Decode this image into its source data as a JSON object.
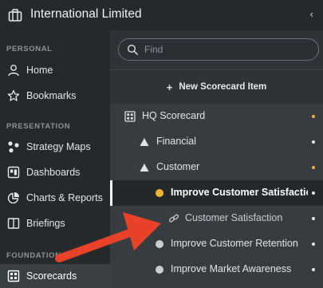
{
  "app": {
    "org_title": "International Limited",
    "collapse_glyph": "‹"
  },
  "sidebar": {
    "sections": [
      {
        "label": "PERSONAL"
      },
      {
        "label": "PRESENTATION"
      },
      {
        "label": "FOUNDATION"
      }
    ],
    "items": [
      {
        "label": "Home",
        "icon": "user-icon"
      },
      {
        "label": "Bookmarks",
        "icon": "star-icon"
      },
      {
        "label": "Strategy Maps",
        "icon": "strategy-map-icon"
      },
      {
        "label": "Dashboards",
        "icon": "dashboard-icon"
      },
      {
        "label": "Charts & Reports",
        "icon": "pie-chart-icon"
      },
      {
        "label": "Briefings",
        "icon": "book-icon"
      },
      {
        "label": "Scorecards",
        "icon": "scorecard-icon",
        "active": true
      }
    ]
  },
  "search": {
    "placeholder": "Find"
  },
  "toolbar": {
    "new_item_label": "New Scorecard Item"
  },
  "tree": {
    "rows": [
      {
        "label": "HQ Scorecard",
        "icon": "scorecard-icon",
        "dot_color": "#f2b233"
      },
      {
        "label": "Financial",
        "icon": "triangle-icon",
        "dot_color": "#e8eaec"
      },
      {
        "label": "Customer",
        "icon": "triangle-icon",
        "dot_color": "#f2b233"
      },
      {
        "label": "Improve Customer Satisfaction",
        "icon": "status-dot-icon",
        "icon_color": "#f2b233",
        "dot_color": "#e8eaec",
        "selected": true
      },
      {
        "label": "Customer Satisfaction",
        "icon": "link-icon",
        "dot_color": "#e8eaec"
      },
      {
        "label": "Improve Customer Retention",
        "icon": "status-dot-icon",
        "icon_color": "#c9cdd1",
        "dot_color": "#e8eaec"
      },
      {
        "label": "Improve Market Awareness",
        "icon": "status-dot-icon",
        "icon_color": "#c9cdd1",
        "dot_color": "#e8eaec"
      }
    ]
  },
  "colors": {
    "annotation_arrow": "#e8432a",
    "status_yellow": "#f2b233"
  }
}
